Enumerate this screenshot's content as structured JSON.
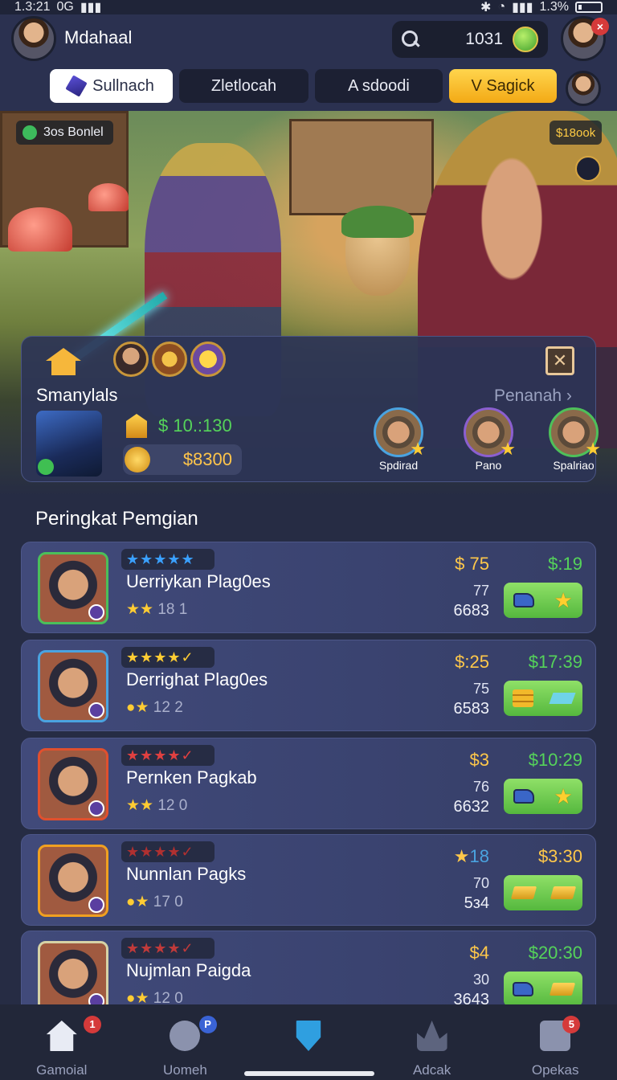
{
  "status_bar": {
    "time": "1.3:21",
    "network": "0G",
    "battery": "1.3%"
  },
  "header": {
    "username": "Mdahaal",
    "search_count": "1031",
    "close_badge": "×"
  },
  "tabs": [
    {
      "label": "Sullnach"
    },
    {
      "label": "Zletlocah"
    },
    {
      "label": "A sdoodi"
    },
    {
      "label": "V Sagick"
    }
  ],
  "hero": {
    "badge_left": "3os Bonlel",
    "badge_right": "$18ook"
  },
  "panel": {
    "name": "Smanylals",
    "more_link": "Penanah ›",
    "money": "$ 10.:130",
    "gold": "$8300",
    "close_symbol": "✕",
    "squad": [
      {
        "name": "Spdirad"
      },
      {
        "name": "Pano"
      },
      {
        "name": "Spalriao"
      }
    ]
  },
  "leaderboard": {
    "title": "Peringkat Pemgian",
    "rows": [
      {
        "stars": "★★★★★",
        "star_color": "#3aa0ff",
        "title": "Uerriykan Plag0es",
        "sub": "18 1",
        "price": "$ 75",
        "n1": "77",
        "n2": "6683",
        "time": "$:19",
        "icons": [
          "shoe-icon",
          "star-icon"
        ]
      },
      {
        "stars": "★★★★✓",
        "star_color": "#ffcc33",
        "title": "Derrighat Plag0es",
        "sub": "12 2",
        "price": "$:25",
        "n1": "75",
        "n2": "6583",
        "time": "$17:39",
        "icons": [
          "gold-bars-icon",
          "gem-icon"
        ]
      },
      {
        "stars": "★★★★✓",
        "star_color": "#e04040",
        "title": "Pernken Pagkab",
        "sub": "12 0",
        "price": "$3",
        "n1": "76",
        "n2": "6632",
        "time": "$10:29",
        "icons": [
          "shoe-icon",
          "star-icon"
        ]
      },
      {
        "stars": "★★★★✓",
        "star_color": "#b03030",
        "title": "Nunnlan Pagks",
        "sub": "17 0",
        "price": "18",
        "n1": "70",
        "n2": "5з4",
        "time": "$3:30",
        "icons": [
          "gold-icon",
          "gold-icon"
        ]
      },
      {
        "stars": "★★★★✓",
        "star_color": "#c03a3a",
        "title": "Nujmlan Paigda",
        "sub": "12 0",
        "price": "$4",
        "n1": "30",
        "n2": "3643",
        "time": "$20:30",
        "icons": [
          "shoe-icon",
          "gold-icon"
        ]
      }
    ]
  },
  "bottom_nav": [
    {
      "label": "Gamoial",
      "icon": "home-icon",
      "badge": "1"
    },
    {
      "label": "Uomeh",
      "icon": "cog-icon",
      "badge": "P"
    },
    {
      "label": "",
      "icon": "shield-icon",
      "badge": ""
    },
    {
      "label": "Adcak",
      "icon": "crown-icon",
      "badge": ""
    },
    {
      "label": "Opekas",
      "icon": "bag-icon",
      "badge": "5"
    }
  ]
}
